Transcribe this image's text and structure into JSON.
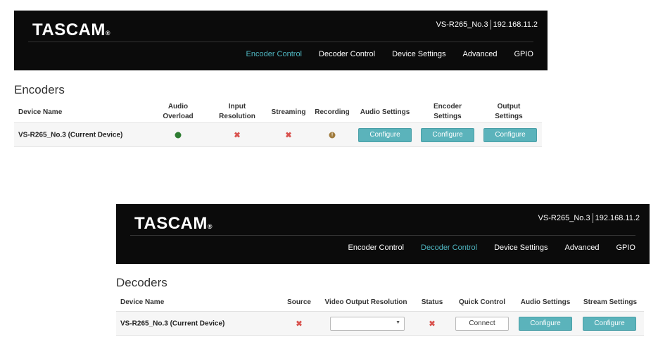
{
  "encoder_page": {
    "logo": "TASCAM",
    "logo_mark": "®",
    "device_name": "VS-R265_No.3",
    "ip": "192.168.11.2",
    "nav": [
      "Encoder Control",
      "Decoder Control",
      "Device Settings",
      "Advanced",
      "GPIO"
    ],
    "active_tab": "Encoder Control",
    "title": "Encoders",
    "columns": {
      "device_name": "Device Name",
      "audio_overload_1": "Audio",
      "audio_overload_2": "Overload",
      "input_resolution_1": "Input",
      "input_resolution_2": "Resolution",
      "streaming": "Streaming",
      "recording": "Recording",
      "audio_settings": "Audio Settings",
      "encoder_settings_1": "Encoder",
      "encoder_settings_2": "Settings",
      "output_settings_1": "Output",
      "output_settings_2": "Settings"
    },
    "row": {
      "device": "VS-R265_No.3 (Current Device)",
      "audio_overload": "ok",
      "input_resolution": "✖",
      "streaming": "✖",
      "recording": "!",
      "configure": "Configure"
    }
  },
  "decoder_page": {
    "logo": "TASCAM",
    "logo_mark": "®",
    "device_name": "VS-R265_No.3",
    "ip": "192.168.11.2",
    "nav": [
      "Encoder Control",
      "Decoder Control",
      "Device Settings",
      "Advanced",
      "GPIO"
    ],
    "active_tab": "Decoder Control",
    "title": "Decoders",
    "columns": {
      "device_name": "Device Name",
      "source": "Source",
      "video_output_resolution": "Video Output Resolution",
      "status": "Status",
      "quick_control": "Quick Control",
      "audio_settings": "Audio Settings",
      "stream_settings": "Stream Settings"
    },
    "row": {
      "device": "VS-R265_No.3 (Current Device)",
      "source": "✖",
      "video_output_resolution": "",
      "status": "✖",
      "connect": "Connect",
      "configure": "Configure"
    }
  },
  "colors": {
    "header_bg": "#0b0b0b",
    "accent": "#4fb7c2",
    "button": "#5bb3bb",
    "error": "#d9534f",
    "ok": "#2e7d32",
    "warning": "#a07b3c"
  },
  "icons": [
    "x-mark-icon",
    "green-dot-icon",
    "warning-icon",
    "dropdown-arrow-icon"
  ]
}
